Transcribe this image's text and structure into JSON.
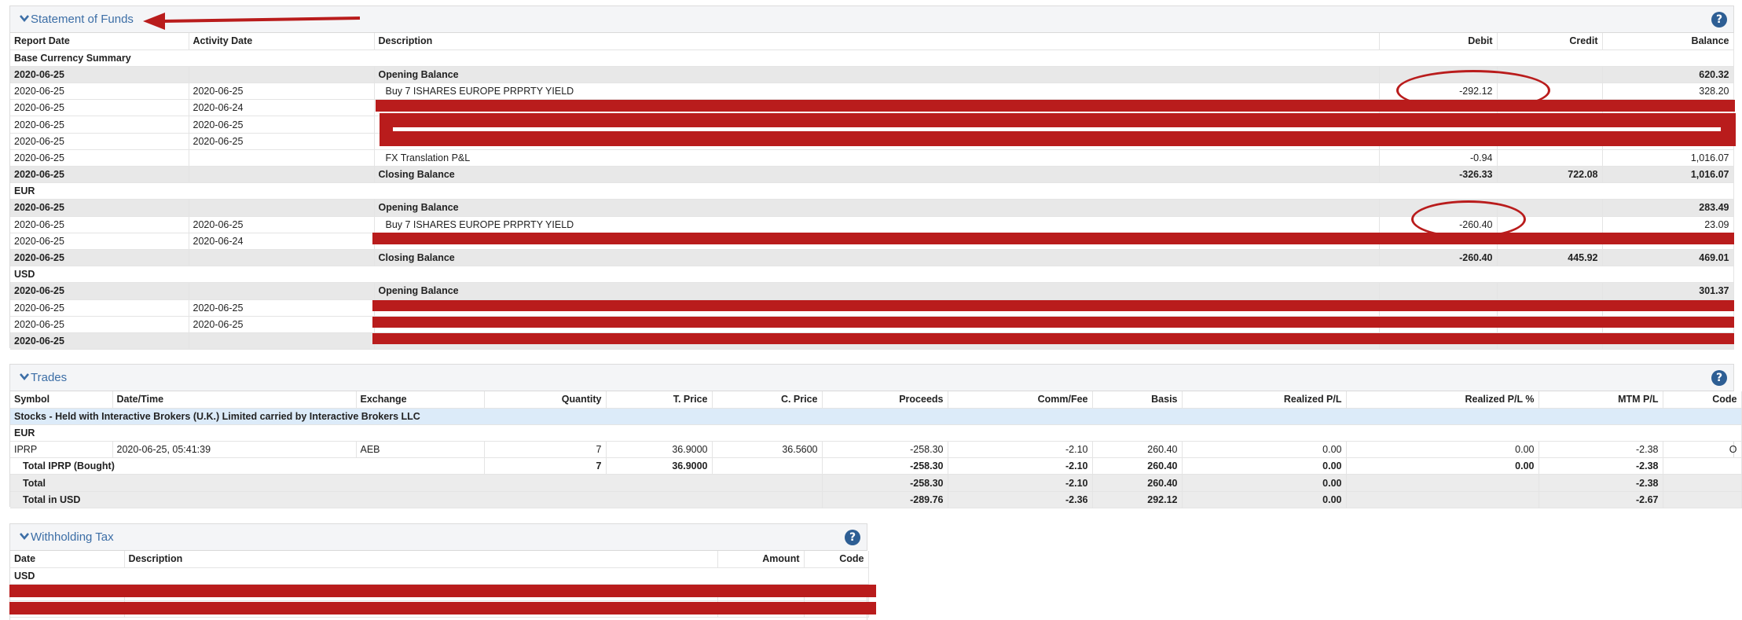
{
  "funds": {
    "title": "Statement of Funds",
    "help_label": "?",
    "headers": [
      "Report Date",
      "Activity Date",
      "Description",
      "Debit",
      "Credit",
      "Balance"
    ],
    "groups": {
      "base": "Base Currency Summary",
      "eur": "EUR",
      "usd": "USD"
    },
    "rows": [
      {
        "report": "2020-06-25",
        "activity": "",
        "desc": "Opening Balance",
        "debit": "",
        "credit": "",
        "balance": "620.32"
      },
      {
        "report": "2020-06-25",
        "activity": "2020-06-25",
        "desc": "Buy 7 ISHARES EUROPE PRPRTY YIELD",
        "debit": "-292.12",
        "credit": "",
        "balance": "328.20"
      },
      {
        "report": "2020-06-25",
        "activity": "2020-06-24",
        "desc": "",
        "debit": "",
        "credit": "",
        "balance": ""
      },
      {
        "report": "2020-06-25",
        "activity": "2020-06-25",
        "desc": "",
        "debit": "",
        "credit": "",
        "balance": ""
      },
      {
        "report": "2020-06-25",
        "activity": "2020-06-25",
        "desc": "",
        "debit": "",
        "credit": "",
        "balance": ""
      },
      {
        "report": "2020-06-25",
        "activity": "",
        "desc": "FX Translation P&L",
        "debit": "-0.94",
        "credit": "",
        "balance": "1,016.07"
      },
      {
        "report": "2020-06-25",
        "activity": "",
        "desc": "Closing Balance",
        "debit": "-326.33",
        "credit": "722.08",
        "balance": "1,016.07"
      },
      {
        "report": "2020-06-25",
        "activity": "",
        "desc": "Opening Balance",
        "debit": "",
        "credit": "",
        "balance": "283.49"
      },
      {
        "report": "2020-06-25",
        "activity": "2020-06-25",
        "desc": "Buy 7 ISHARES EUROPE PRPRTY YIELD",
        "debit": "-260.40",
        "credit": "",
        "balance": "23.09"
      },
      {
        "report": "2020-06-25",
        "activity": "2020-06-24",
        "desc": "",
        "debit": "",
        "credit": "",
        "balance": ""
      },
      {
        "report": "2020-06-25",
        "activity": "",
        "desc": "Closing Balance",
        "debit": "-260.40",
        "credit": "445.92",
        "balance": "469.01"
      },
      {
        "report": "2020-06-25",
        "activity": "",
        "desc": "Opening Balance",
        "debit": "",
        "credit": "",
        "balance": "301.37"
      },
      {
        "report": "2020-06-25",
        "activity": "2020-06-25",
        "desc": "",
        "debit": "",
        "credit": "",
        "balance": ""
      },
      {
        "report": "2020-06-25",
        "activity": "2020-06-25",
        "desc": "",
        "debit": "",
        "credit": "",
        "balance": ""
      },
      {
        "report": "2020-06-25",
        "activity": "",
        "desc": "",
        "debit": "",
        "credit": "",
        "balance": ""
      }
    ]
  },
  "trades": {
    "title": "Trades",
    "help_label": "?",
    "headers": [
      "Symbol",
      "Date/Time",
      "Exchange",
      "Quantity",
      "T. Price",
      "C. Price",
      "Proceeds",
      "Comm/Fee",
      "Basis",
      "Realized P/L",
      "Realized P/L %",
      "MTM P/L",
      "Code"
    ],
    "stocks_label": "Stocks - Held with Interactive Brokers (U.K.) Limited carried by Interactive Brokers LLC",
    "currency": "EUR",
    "trade": {
      "symbol": "IPRP",
      "datetime": "2020-06-25, 05:41:39",
      "exchange": "AEB",
      "quantity": "7",
      "tprice": "36.9000",
      "cprice": "36.5600",
      "proceeds": "-258.30",
      "comm": "-2.10",
      "basis": "260.40",
      "rpl": "0.00",
      "rplpct": "0.00",
      "mtm": "-2.38",
      "code": "O"
    },
    "subtotal": {
      "label": "Total IPRP (Bought)",
      "quantity": "7",
      "tprice": "36.9000",
      "proceeds": "-258.30",
      "comm": "-2.10",
      "basis": "260.40",
      "rpl": "0.00",
      "rplpct": "0.00",
      "mtm": "-2.38"
    },
    "total": {
      "label": "Total",
      "proceeds": "-258.30",
      "comm": "-2.10",
      "basis": "260.40",
      "rpl": "0.00",
      "mtm": "-2.38"
    },
    "total_usd": {
      "label": "Total in USD",
      "proceeds": "-289.76",
      "comm": "-2.36",
      "basis": "292.12",
      "rpl": "0.00",
      "mtm": "-2.67"
    }
  },
  "withholding": {
    "title": "Withholding Tax",
    "help_label": "?",
    "headers": [
      "Date",
      "Description",
      "Amount",
      "Code"
    ],
    "currency": "USD"
  },
  "colors": {
    "accent": "#3c6ea6",
    "redaction": "#b91c1c",
    "highlight_row": "#dcebf9"
  }
}
